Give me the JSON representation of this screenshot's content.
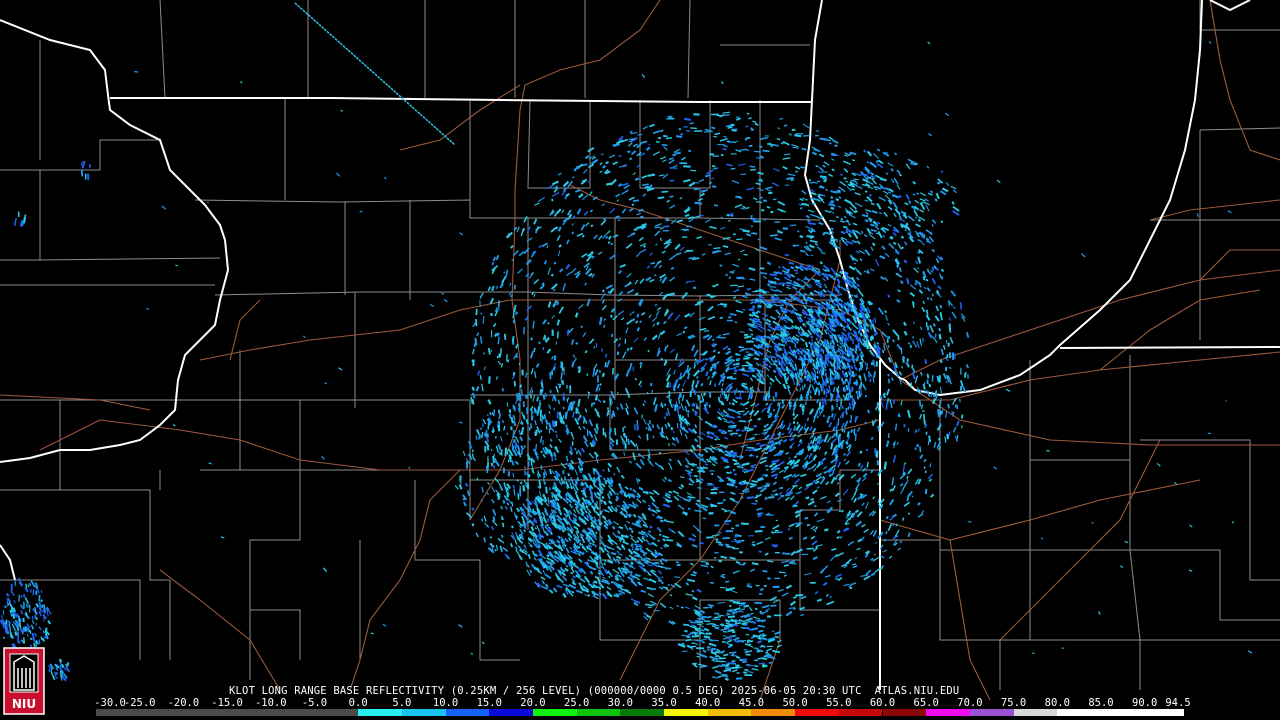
{
  "product_caption": "KLOT LONG RANGE BASE REFLECTIVITY (0.25KM / 256 LEVEL) (000000/0000 0.5 DEG) 2025-06-05 20:30 UTC  ATLAS.NIU.EDU",
  "logo_text": "NIU",
  "colorbar": {
    "tick_labels": [
      "-30.0",
      "-25.0",
      "-20.0",
      "-15.0",
      "-10.0",
      "-5.0",
      "0.0",
      "5.0",
      "10.0",
      "15.0",
      "20.0",
      "25.0",
      "30.0",
      "35.0",
      "40.0",
      "45.0",
      "50.0",
      "55.0",
      "60.0",
      "65.0",
      "70.0",
      "75.0",
      "80.0",
      "85.0",
      "90.0",
      "94.5"
    ],
    "segments": [
      {
        "from": -30,
        "to": 0,
        "color": "#4a4a4a"
      },
      {
        "from": 0,
        "to": 5,
        "color": "#29f0f0"
      },
      {
        "from": 5,
        "to": 10,
        "color": "#1ac2f2"
      },
      {
        "from": 10,
        "to": 15,
        "color": "#1463f5"
      },
      {
        "from": 15,
        "to": 20,
        "color": "#0a0ad8"
      },
      {
        "from": 20,
        "to": 25,
        "color": "#10f010"
      },
      {
        "from": 25,
        "to": 30,
        "color": "#0cc20c"
      },
      {
        "from": 30,
        "to": 35,
        "color": "#087a08"
      },
      {
        "from": 35,
        "to": 40,
        "color": "#f5f50a"
      },
      {
        "from": 40,
        "to": 45,
        "color": "#f0bd08"
      },
      {
        "from": 45,
        "to": 50,
        "color": "#f08a0a"
      },
      {
        "from": 50,
        "to": 55,
        "color": "#f00a0a"
      },
      {
        "from": 55,
        "to": 60,
        "color": "#c20808"
      },
      {
        "from": 60,
        "to": 65,
        "color": "#8c0505"
      },
      {
        "from": 65,
        "to": 70,
        "color": "#f00af0"
      },
      {
        "from": 70,
        "to": 75,
        "color": "#9a52d2"
      },
      {
        "from": 75,
        "to": 80,
        "color": "#d8d8d8"
      },
      {
        "from": 80,
        "to": 94.5,
        "color": "#ffffff"
      }
    ]
  },
  "colors": {
    "background": "#000000",
    "state_border": "#ffffff",
    "county_border": "#8c8c8c",
    "highway": "#9a5a3a",
    "echo_light": "#29c8e6",
    "echo_mid": "#1e9aea",
    "echo_heavy": "#1e64f0"
  }
}
